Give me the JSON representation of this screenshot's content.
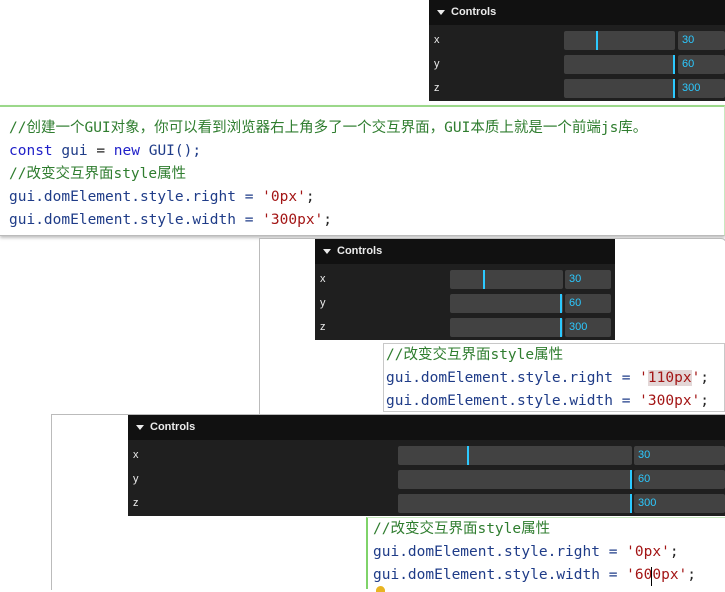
{
  "gui_title": "Controls",
  "controls": [
    {
      "label": "x",
      "value": "30",
      "level": 0.3
    },
    {
      "label": "y",
      "value": "60",
      "level": 1.0
    },
    {
      "label": "z",
      "value": "300",
      "level": 1.0
    }
  ],
  "snippet1": {
    "comment1": "//创建一个GUI对象，你可以看到浏览器右上角多了一个交互界面，GUI本质上就是一个前端js库。",
    "l2_kw": "const",
    "l2_var": " gui ",
    "l2_eq": "= ",
    "l2_new": "new",
    "l2_ctor": " GUI();",
    "comment2": "//改变交互界面style属性",
    "l4_code": "gui.domElement.style.right = ",
    "l4_str": "'0px'",
    "l4_end": ";",
    "l5_code": "gui.domElement.style.width = ",
    "l5_str": "'300px'",
    "l5_end": ";"
  },
  "snippet2": {
    "comment": "//改变交互界面style属性",
    "right_code": "gui.domElement.style.right = ",
    "right_q1": "'",
    "right_val": "110px",
    "right_q2": "'",
    "right_end": ";",
    "width_code": "gui.domElement.style.width = ",
    "width_str": "'300px'",
    "width_end": ";"
  },
  "snippet3": {
    "comment": "//改变交互界面style属性",
    "right_code": "gui.domElement.style.right = ",
    "right_str": "'0px'",
    "right_end": ";",
    "width_code": "gui.domElement.style.width = ",
    "width_str": "'600px'",
    "width_end": ";"
  }
}
